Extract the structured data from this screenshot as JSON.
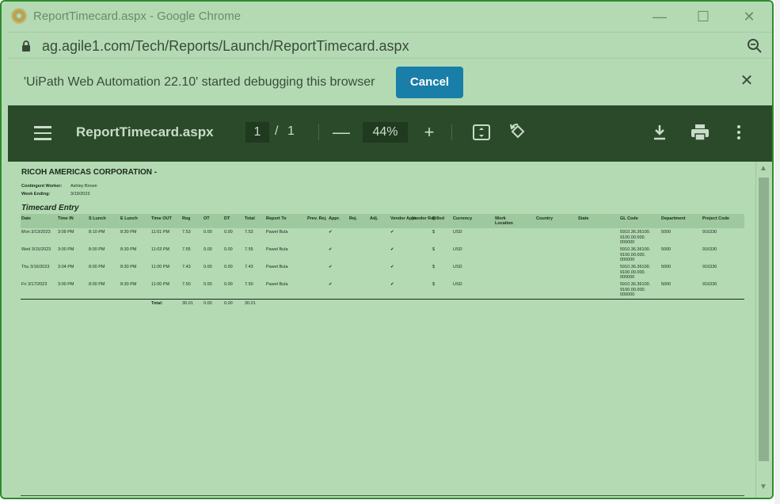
{
  "window": {
    "title": "ReportTimecard.aspx - Google Chrome",
    "minimize": "—",
    "maximize": "☐",
    "close": "✕"
  },
  "address": {
    "url": "ag.agile1.com/Tech/Reports/Launch/ReportTimecard.aspx"
  },
  "debug": {
    "message": "'UiPath Web Automation 22.10' started debugging this browser",
    "cancel_label": "Cancel",
    "close": "✕"
  },
  "toolbar": {
    "title": "ReportTimecard.aspx",
    "page_current": "1",
    "page_sep": "/",
    "page_total": "1",
    "zoom_out": "—",
    "zoom_level": "44%",
    "zoom_in": "+",
    "fit_icon": "⤢",
    "rotate_icon": "⟲",
    "download_icon": "⤓",
    "print_icon": "⎙",
    "more_icon": "⋮"
  },
  "report": {
    "company": "RICOH AMERICAS CORPORATION -",
    "worker_label": "Contingent Worker:",
    "worker_value": "Ashley Brown",
    "week_label": "Week Ending:",
    "week_value": "3/19/2023",
    "section_title": "Timecard Entry",
    "columns": [
      "Date",
      "Time IN",
      "S Lunch",
      "E Lunch",
      "Time OUT",
      "Reg",
      "OT",
      "DT",
      "Total",
      "Report To",
      "Prev. Rej.",
      "Appr.",
      "Rej.",
      "Adj.",
      "Vendor Appr.",
      "Vendor Rej",
      "Billed",
      "Currency",
      "Work Location",
      "Country",
      "State",
      "GL Code",
      "Department",
      "Project Code"
    ],
    "rows": [
      [
        "Mon 3/13/2023",
        "3:09 PM",
        "8:10 PM",
        "8:30 PM",
        "11:01 PM",
        "7.53",
        "0.00",
        "0.00",
        "7.53",
        "Pawel Bula",
        "",
        "✔",
        "",
        "",
        "✔",
        "",
        "$",
        "USD",
        "",
        "",
        "",
        "5910.36.36100. 9100.00.000. 000000",
        "5000",
        "916330"
      ],
      [
        "Wed 3/15/2023",
        "3:00 PM",
        "8:00 PM",
        "8:30 PM",
        "11:03 PM",
        "7.55",
        "0.00",
        "0.00",
        "7.55",
        "Pawel Bula",
        "",
        "✔",
        "",
        "",
        "✔",
        "",
        "$",
        "USD",
        "",
        "",
        "",
        "5910.36.36100. 9100.00.000. 000000",
        "5000",
        "916330"
      ],
      [
        "Thu 3/16/2023",
        "3:04 PM",
        "8:00 PM",
        "8:30 PM",
        "11:00 PM",
        "7.43",
        "0.00",
        "0.00",
        "7.43",
        "Pawel Bula",
        "",
        "✔",
        "",
        "",
        "✔",
        "",
        "$",
        "USD",
        "",
        "",
        "",
        "5910.36.36100. 9100.00.000. 000000",
        "5000",
        "916330"
      ],
      [
        "Fri 3/17/2023",
        "3:00 PM",
        "8:00 PM",
        "8:30 PM",
        "11:00 PM",
        "7.50",
        "0.00",
        "0.00",
        "7.50",
        "Pawel Bula",
        "",
        "✔",
        "",
        "",
        "✔",
        "",
        "$",
        "USD",
        "",
        "",
        "",
        "5910.36.36100. 9100.00.000. 000000",
        "5000",
        "916330"
      ]
    ],
    "total_label": "Total:",
    "total_reg": "30.01",
    "total_ot": "0.00",
    "total_dt": "0.00",
    "total_total": "30.01"
  },
  "scroll": {
    "up": "▲",
    "down": "▼"
  }
}
